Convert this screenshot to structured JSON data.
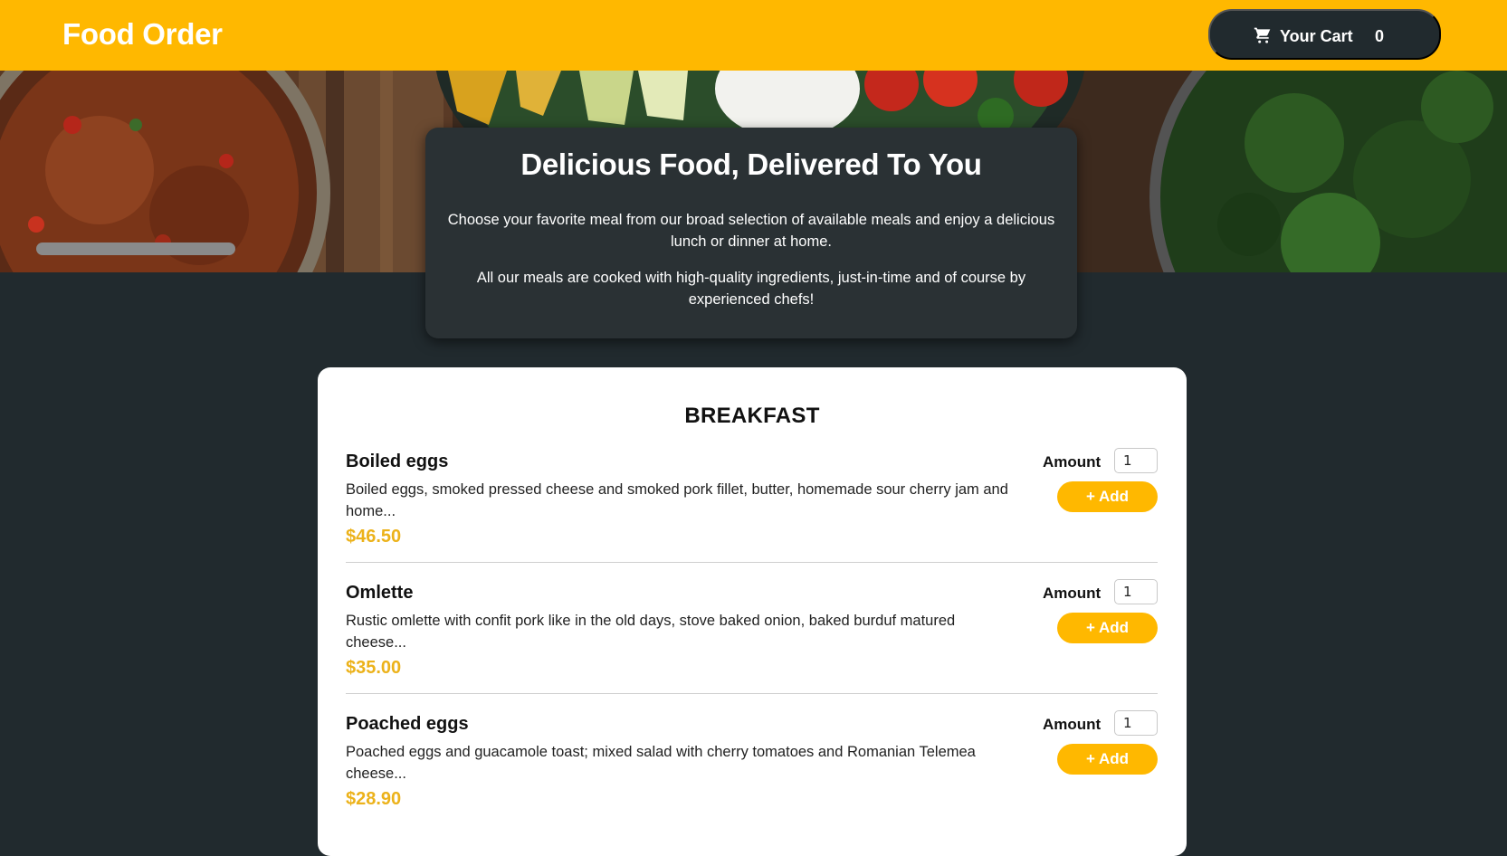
{
  "header": {
    "brand": "Food Order",
    "cart_label": "Your Cart",
    "cart_count": "0",
    "cart_icon": "cart-icon"
  },
  "summary": {
    "title": "Delicious Food, Delivered To You",
    "paragraph_1": "Choose your favorite meal from our broad selection of available meals and enjoy a delicious lunch or dinner at home.",
    "paragraph_2": "All our meals are cooked with high-quality ingredients, just-in-time and of course by experienced chefs!"
  },
  "menu": {
    "section_title": "BREAKFAST",
    "amount_label": "Amount",
    "add_label": "+ Add",
    "meals": [
      {
        "name": "Boiled eggs",
        "description": "Boiled eggs, smoked pressed cheese and smoked pork fillet, butter, homemade sour cherry jam and home...",
        "price": "$46.50",
        "amount": "1"
      },
      {
        "name": "Omlette",
        "description": "Rustic omlette with confit pork like in the old days, stove baked onion, baked burduf matured cheese...",
        "price": "$35.00",
        "amount": "1"
      },
      {
        "name": "Poached eggs",
        "description": "Poached eggs and guacamole toast; mixed salad with cherry tomatoes and Romanian Telemea cheese...",
        "price": "$28.90",
        "amount": "1"
      }
    ]
  },
  "colors": {
    "accent": "#ffb800",
    "background": "#212a2e",
    "price": "#ecb21a"
  }
}
